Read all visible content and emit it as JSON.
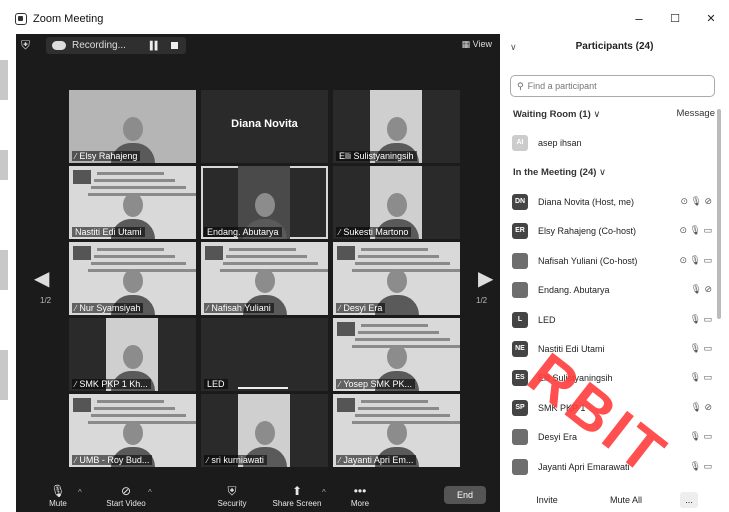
{
  "window": {
    "title": "Zoom Meeting",
    "controls": {
      "minimize": "–",
      "maximize": "☐",
      "close": "✕"
    }
  },
  "topbar": {
    "recording_label": "Recording...",
    "view_label": "View"
  },
  "tiles": [
    {
      "name": "Elsy Rahajeng",
      "kind": "camera",
      "muted": true
    },
    {
      "name": "",
      "big_name": "Diana Novita",
      "kind": "plain",
      "muted": false
    },
    {
      "name": "Elli Sulistyaningsih",
      "kind": "camera",
      "muted": false
    },
    {
      "name": "Nastiti Edi Utami",
      "kind": "slide",
      "muted": false
    },
    {
      "name": "Endang. Abutarya",
      "kind": "camera",
      "muted": false,
      "active": true
    },
    {
      "name": "Sukesti Martono",
      "kind": "camera",
      "muted": true
    },
    {
      "name": "Nur Syamsiyah",
      "kind": "slide",
      "muted": true
    },
    {
      "name": "Nafisah Yuliani",
      "kind": "slide",
      "muted": true
    },
    {
      "name": "Desyi Era",
      "kind": "slide",
      "muted": true
    },
    {
      "name": "SMK PKP 1 Kh...",
      "kind": "camera",
      "muted": true
    },
    {
      "name": "LED",
      "kind": "plain",
      "muted": false
    },
    {
      "name": "Yosep SMK PK...",
      "kind": "slide",
      "muted": true
    },
    {
      "name": "UMB - Roy Bud...",
      "kind": "slide",
      "muted": true
    },
    {
      "name": "sri kurniawati",
      "kind": "camera",
      "muted": true
    },
    {
      "name": "Jayanti Apri Em...",
      "kind": "slide",
      "muted": true
    }
  ],
  "pager": {
    "left": "1/2",
    "right": "1/2"
  },
  "toolbar": {
    "mute": "Mute",
    "start_video": "Start Video",
    "security": "Security",
    "share_screen": "Share Screen",
    "more": "More",
    "more_dots": "•••",
    "end": "End"
  },
  "panel": {
    "title": "Participants (24)",
    "search_placeholder": "Find a participant",
    "waiting_room": "Waiting Room (1)",
    "message": "Message",
    "in_meeting": "In the Meeting (24)",
    "waiting": [
      {
        "initials": "AI",
        "name": "asep ihsan"
      }
    ],
    "participants": [
      {
        "initials": "DN",
        "name": "Diana Novita (Host, me)",
        "icons": "⊙ 🎙 ⊘"
      },
      {
        "initials": "ER",
        "name": "Elsy Rahajeng (Co-host)",
        "icons": "⊙ 🎙 ▭"
      },
      {
        "initials": "",
        "name": "Nafisah Yuliani (Co-host)",
        "icons": "⊙ 🎙 ▭"
      },
      {
        "initials": "",
        "name": "Endang. Abutarya",
        "icons": "🎙 ⊘"
      },
      {
        "initials": "L",
        "name": "LED",
        "icons": "🎙 ▭"
      },
      {
        "initials": "NE",
        "name": "Nastiti Edi Utami",
        "icons": "🎙 ▭"
      },
      {
        "initials": "ES",
        "name": "Elli Sulistyaningsih",
        "icons": "🎙 ▭"
      },
      {
        "initials": "SP",
        "name": "SMK PKP 1",
        "icons": "🎙 ⊘"
      },
      {
        "initials": "",
        "name": "Desyi Era",
        "icons": "🎙 ▭"
      },
      {
        "initials": "",
        "name": "Jayanti Apri Emarawati",
        "icons": "🎙 ▭"
      }
    ],
    "invite": "Invite",
    "mute_all": "Mute All",
    "more": "..."
  },
  "watermark": "RBIT"
}
